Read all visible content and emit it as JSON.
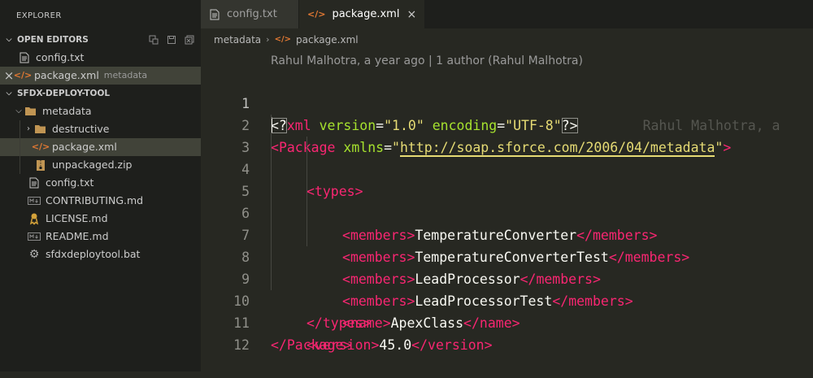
{
  "sidebar": {
    "title": "EXPLORER",
    "open_editors": {
      "label": "OPEN EDITORS",
      "items": [
        {
          "name": "config.txt",
          "icon": "text-file-icon"
        },
        {
          "name": "package.xml",
          "description": "metadata",
          "icon": "xml-file-icon",
          "close": "×"
        }
      ]
    },
    "project": {
      "label": "SFDX-DEPLOY-TOOL",
      "tree": [
        {
          "name": "metadata",
          "icon": "folder-open-icon"
        },
        {
          "name": "destructive",
          "icon": "folder-icon"
        },
        {
          "name": "package.xml",
          "icon": "xml-file-icon"
        },
        {
          "name": "unpackaged.zip",
          "icon": "zip-file-icon"
        },
        {
          "name": "config.txt",
          "icon": "text-file-icon"
        },
        {
          "name": "CONTRIBUTING.md",
          "icon": "markdown-icon"
        },
        {
          "name": "LICENSE.md",
          "icon": "license-icon"
        },
        {
          "name": "README.md",
          "icon": "markdown-icon"
        },
        {
          "name": "sfdxdeploytool.bat",
          "icon": "gear-icon"
        }
      ]
    }
  },
  "tabs": [
    {
      "label": "config.txt",
      "icon": "text-file-icon"
    },
    {
      "label": "package.xml",
      "icon": "xml-file-icon",
      "close": "×"
    }
  ],
  "breadcrumb": {
    "folder": "metadata",
    "file": "package.xml"
  },
  "codelens": "Rahul Malhotra, a year ago | 1 author (Rahul Malhotra)",
  "blame_inline": "Rahul Malhotra, a",
  "code": {
    "line_numbers": [
      "1",
      "2",
      "3",
      "4",
      "5",
      "6",
      "7",
      "8",
      "9",
      "10",
      "11",
      "12"
    ],
    "xml_decl": {
      "open": "<?",
      "name": "xml",
      "a1": "version",
      "v1": "\"1.0\"",
      "a2": "encoding",
      "v2": "\"UTF-8\"",
      "close": "?>"
    },
    "package_tag": "Package",
    "xmlns_attr": "xmlns",
    "xmlns_value": "http://soap.sforce.com/2006/04/metadata",
    "types_tag": "types",
    "members_tag": "members",
    "members": [
      "TemperatureConverter",
      "TemperatureConverterTest",
      "LeadProcessor",
      "LeadProcessorTest"
    ],
    "name_tag": "name",
    "name_value": "ApexClass",
    "version_tag": "version",
    "version_value": "45.0"
  },
  "colors": {
    "tag": "#f92672",
    "attribute": "#a6e22e",
    "string": "#e6db74",
    "text": "#f8f8f2",
    "background": "#272822"
  }
}
